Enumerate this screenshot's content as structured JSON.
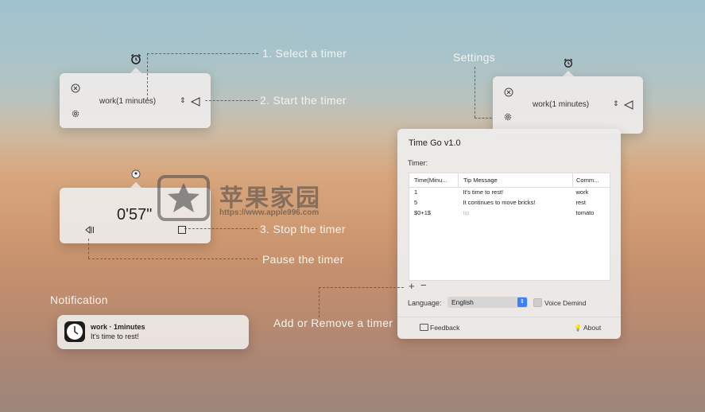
{
  "callouts": {
    "select_timer": "1. Select a timer",
    "start_timer": "2. Start the timer",
    "stop_timer": "3. Stop the timer",
    "pause_timer": "Pause the timer",
    "settings": "Settings",
    "notification": "Notification",
    "add_remove": "Add or Remove a timer"
  },
  "widget1": {
    "timer": "work(1 minutes)"
  },
  "widget2": {
    "time": "0'57\""
  },
  "widget3": {
    "timer": "work(1 minutes)"
  },
  "watermark": {
    "title": "苹果家园",
    "url": "https://www.apple996.com"
  },
  "settings_window": {
    "title": "Time Go v1.0",
    "timer_label": "Timer:",
    "columns": [
      "Time(Minu...",
      "Tip Message",
      "Comm..."
    ],
    "rows": [
      {
        "time": "1",
        "tip": "It's time to rest!",
        "command": "work"
      },
      {
        "time": "5",
        "tip": "It continues to move bricks!",
        "command": "rest"
      },
      {
        "time": "$0+1$",
        "tip": "tip",
        "command": "tomato"
      }
    ],
    "language_label": "Language:",
    "language_value": "English",
    "voice_label": "Voice Demind",
    "feedback": "Feedback",
    "about": "About"
  },
  "notification": {
    "title": "work · 1minutes",
    "body": "It's time to rest!"
  },
  "icons": [
    "alarm-clock-icon",
    "close-circle-icon",
    "gear-icon",
    "stepper-icon",
    "play-icon",
    "pause-icon",
    "stop-icon",
    "clock-app-icon",
    "star-logo-icon",
    "feedback-icon",
    "bulb-icon",
    "plus-icon",
    "minus-icon"
  ]
}
